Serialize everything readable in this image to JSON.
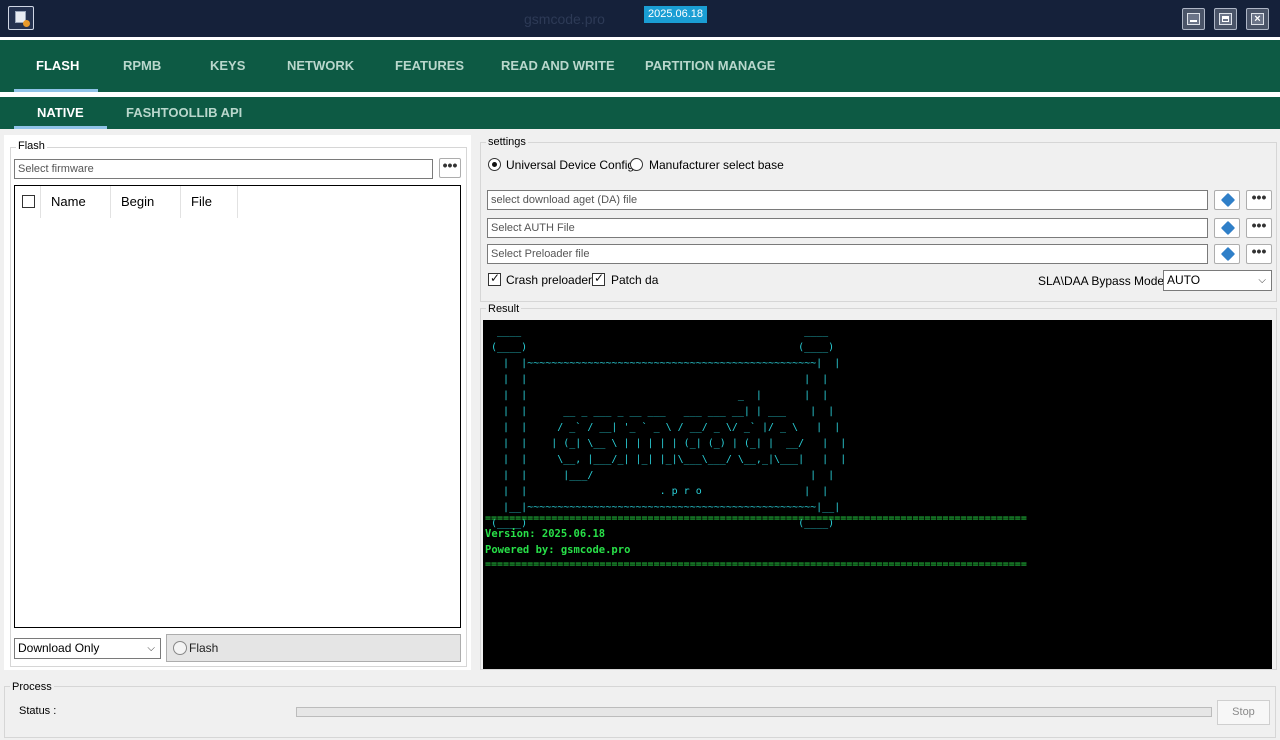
{
  "titlebar": {
    "title": "gsmcode.pro",
    "version_badge": "2025.06.18"
  },
  "main_tabs": [
    "FLASH",
    "RPMB",
    "KEYS",
    "NETWORK",
    "FEATURES",
    "READ AND WRITE",
    "PARTITION MANAGE"
  ],
  "sub_tabs": [
    "NATIVE",
    "FASHTOOLLIB API"
  ],
  "flash": {
    "legend": "Flash",
    "firmware_placeholder": "Select firmware",
    "browse_label": "•••",
    "columns": [
      "Name",
      "Begin",
      "File"
    ],
    "mode_selected": "Download Only",
    "flash_button": "Flash"
  },
  "settings": {
    "legend": "settings",
    "radio_universal": "Universal Device Config",
    "radio_manufacturer": "Manufacturer select base",
    "da_placeholder": "select download aget (DA) file",
    "auth_placeholder": "Select AUTH File",
    "preloader_placeholder": "Select Preloader file",
    "browse_label": "•••",
    "crash_preloader": "Crash preloader",
    "patch_da": "Patch da",
    "bypass_label": "SLA\\DAA Bypass Mode:",
    "bypass_selected": "AUTO"
  },
  "result": {
    "legend": "Result",
    "version_line": "Version: 2025.06.18",
    "powered_line": "Powered by: gsmcode.pro"
  },
  "process": {
    "legend": "Process",
    "status_label": "Status :",
    "progress": 0,
    "stop_button": "Stop"
  },
  "colors": {
    "titlebar": "#15213a",
    "tab_bar": "#0d5a44",
    "console_cyan": "#2ad0d8",
    "console_green": "#28e048",
    "badge": "#1a9ed4"
  }
}
